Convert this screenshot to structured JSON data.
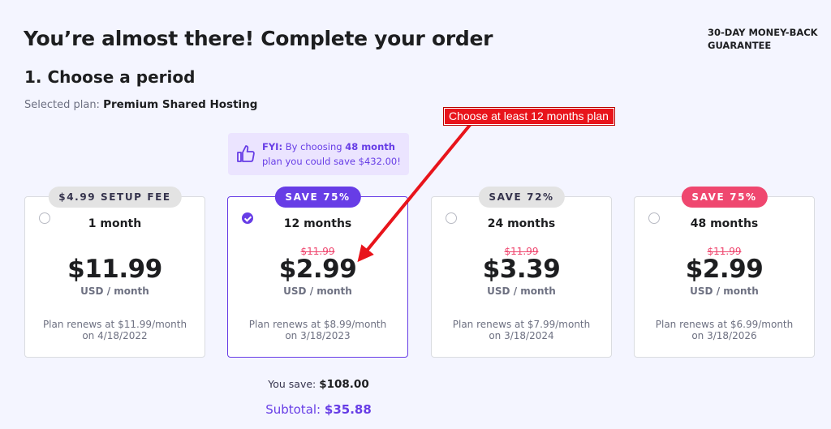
{
  "header": {
    "title": "You’re almost there! Complete your order",
    "guarantee": "30-DAY MONEY-BACK GUARANTEE"
  },
  "section": {
    "title": "1. Choose a period",
    "selected_label": "Selected plan:",
    "selected_value": "Premium Shared Hosting"
  },
  "fyi": {
    "icon": "thumbs-up-icon",
    "prefix": "FYI:",
    "text_part1": "By choosing",
    "highlight": "48 month",
    "text_part2": "plan you could save $432.00!"
  },
  "annotation": {
    "label": "Choose at least 12 months plan",
    "color": "#e8141b"
  },
  "plans": [
    {
      "badge": "$4.99 SETUP FEE",
      "badge_style": "gray",
      "period": "1 month",
      "old_price": "",
      "price": "$11.99",
      "unit": "USD / month",
      "renew_line1": "Plan renews at $11.99/month",
      "renew_line2": "on 4/18/2022",
      "selected": false
    },
    {
      "badge": "SAVE 75%",
      "badge_style": "purple",
      "period": "12 months",
      "old_price": "$11.99",
      "price": "$2.99",
      "unit": "USD / month",
      "renew_line1": "Plan renews at $8.99/month",
      "renew_line2": "on 3/18/2023",
      "selected": true
    },
    {
      "badge": "SAVE 72%",
      "badge_style": "gray",
      "period": "24 months",
      "old_price": "$11.99",
      "price": "$3.39",
      "unit": "USD / month",
      "renew_line1": "Plan renews at $7.99/month",
      "renew_line2": "on 3/18/2024",
      "selected": false
    },
    {
      "badge": "SAVE 75%",
      "badge_style": "pink",
      "period": "48 months",
      "old_price": "$11.99",
      "price": "$2.99",
      "unit": "USD / month",
      "renew_line1": "Plan renews at $6.99/month",
      "renew_line2": "on 3/18/2026",
      "selected": false
    }
  ],
  "summary": {
    "you_save_label": "You save:",
    "you_save_value": "$108.00",
    "subtotal_label": "Subtotal:",
    "subtotal_value": "$35.88"
  },
  "colors": {
    "accent": "#673de6",
    "sale": "#ef476f",
    "background": "#f4f5ff"
  }
}
